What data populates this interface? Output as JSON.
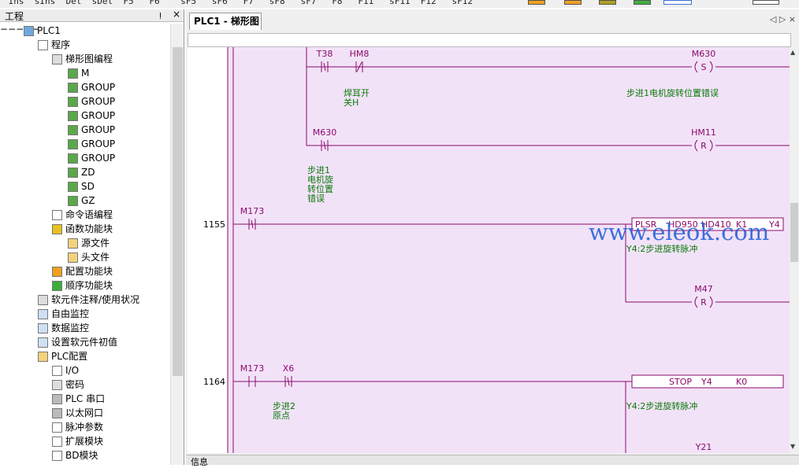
{
  "toolbar": {
    "keys": " Ins  sIns  Del  sDel  F5   F6    sF5   sF6   F7   sF8   sF7   F8   F11   sF11  F12   sF12"
  },
  "project_pane": {
    "title": "工程",
    "pin": "ᴉ",
    "close": "×",
    "tree": [
      {
        "label": "PLC1",
        "level": 0,
        "icon": "plc-icon"
      },
      {
        "label": "程序",
        "level": 1,
        "icon": "document-icon"
      },
      {
        "label": "梯形图编程",
        "level": 2,
        "icon": "ladder-icon"
      },
      {
        "label": "M",
        "level": 3,
        "icon": "block-icon"
      },
      {
        "label": "GROUP",
        "level": 3,
        "icon": "block-icon"
      },
      {
        "label": "GROUP",
        "level": 3,
        "icon": "block-icon"
      },
      {
        "label": "GROUP",
        "level": 3,
        "icon": "block-icon"
      },
      {
        "label": "GROUP",
        "level": 3,
        "icon": "block-icon"
      },
      {
        "label": "GROUP",
        "level": 3,
        "icon": "block-icon"
      },
      {
        "label": "GROUP",
        "level": 3,
        "icon": "block-icon"
      },
      {
        "label": "ZD",
        "level": 3,
        "icon": "block-icon"
      },
      {
        "label": "SD",
        "level": 3,
        "icon": "block-icon"
      },
      {
        "label": "GZ",
        "level": 3,
        "icon": "block-icon"
      },
      {
        "label": "命令语编程",
        "level": 2,
        "icon": "command-icon"
      },
      {
        "label": "函数功能块",
        "level": 2,
        "icon": "function-block-icon"
      },
      {
        "label": "源文件",
        "level": 3,
        "icon": "folder-icon"
      },
      {
        "label": "头文件",
        "level": 3,
        "icon": "folder-icon"
      },
      {
        "label": "配置功能块",
        "level": 2,
        "icon": "config-block-icon"
      },
      {
        "label": "顺序功能块",
        "level": 2,
        "icon": "sequence-block-icon"
      },
      {
        "label": "软元件注释/使用状况",
        "level": 1,
        "icon": "list-icon"
      },
      {
        "label": "自由监控",
        "level": 1,
        "icon": "monitor-icon"
      },
      {
        "label": "数据监控",
        "level": 1,
        "icon": "data-monitor-icon"
      },
      {
        "label": "设置软元件初值",
        "level": 1,
        "icon": "grid-icon"
      },
      {
        "label": "PLC配置",
        "level": 1,
        "icon": "folder-icon"
      },
      {
        "label": "I/O",
        "level": 2,
        "icon": "io-icon"
      },
      {
        "label": "密码",
        "level": 2,
        "icon": "password-icon"
      },
      {
        "label": "PLC 串口",
        "level": 2,
        "icon": "serial-icon"
      },
      {
        "label": "以太网口",
        "level": 2,
        "icon": "ethernet-icon"
      },
      {
        "label": "脉冲参数",
        "level": 2,
        "icon": "pulse-icon"
      },
      {
        "label": "扩展模块",
        "level": 2,
        "icon": "expansion-icon"
      },
      {
        "label": "BD模块",
        "level": 2,
        "icon": "bd-icon"
      }
    ]
  },
  "editor": {
    "tab_label": "PLC1 - 梯形图",
    "tab_nav": "◁ ▷ ×",
    "bottom_label": "信息",
    "watermark": "www.eleok.com",
    "rung_numbers": [
      "1155",
      "1164"
    ],
    "contacts": [
      {
        "label": "T38",
        "type": "rising"
      },
      {
        "label": "HM8",
        "type": "nc"
      },
      {
        "label": "M630",
        "type": "rising"
      },
      {
        "label": "M173",
        "type": "rising"
      },
      {
        "label": "M173",
        "type": "no"
      },
      {
        "label": "X6",
        "type": "rising"
      }
    ],
    "coils": [
      {
        "name": "M630",
        "op": "S"
      },
      {
        "name": "HM11",
        "op": "R"
      },
      {
        "name": "M47",
        "op": "R"
      },
      {
        "name": "Y21",
        "op": ""
      }
    ],
    "instructions": [
      {
        "parts": [
          "PLSR",
          "HD950",
          "HD410",
          "K1",
          "Y4"
        ]
      },
      {
        "parts": [
          "STOP",
          "Y4",
          "K0"
        ]
      }
    ],
    "comments": {
      "hm8": [
        "焊耳开",
        "关H"
      ],
      "m630_coil": "步进1电机旋转位置错误",
      "m630_contact": [
        "步进1",
        "电机旋",
        "转位置",
        "错误"
      ],
      "plsr": "Y4:2步进旋转脉冲",
      "x6": [
        "步进2",
        "原点"
      ],
      "stop": "Y4:2步进旋转脉冲"
    }
  },
  "colors": {
    "ladder_bg": "#f2e2f8",
    "ladder_line": "#8a0a6a",
    "comment_text": "#0a7a0a",
    "watermark": "#1e5bd6"
  }
}
